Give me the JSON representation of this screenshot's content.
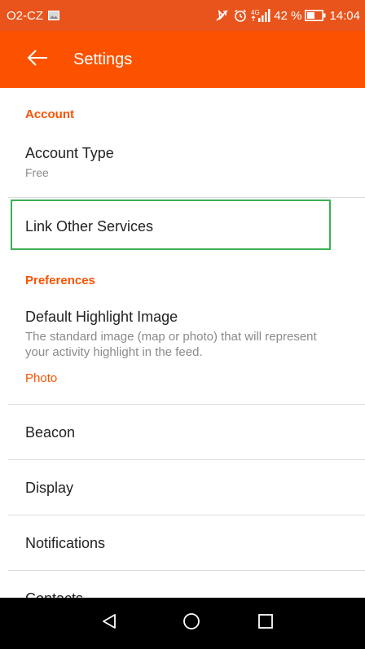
{
  "status_bar": {
    "carrier": "O2-CZ",
    "network": "4G",
    "battery_percent": "42 %",
    "time": "14:04",
    "icons": [
      "image-icon",
      "mute-icon",
      "alarm-icon",
      "signal-icon",
      "battery-icon"
    ]
  },
  "app_bar": {
    "title": "Settings",
    "back_icon": "arrow-left-icon"
  },
  "sections": {
    "account": {
      "header": "Account",
      "account_type": {
        "title": "Account Type",
        "value": "Free"
      },
      "link_services": {
        "title": "Link Other Services"
      }
    },
    "preferences": {
      "header": "Preferences",
      "highlight_image": {
        "title": "Default Highlight Image",
        "description": "The standard image (map or photo) that will represent your activity highlight in the feed.",
        "value": "Photo"
      }
    }
  },
  "items": [
    "Beacon",
    "Display",
    "Notifications",
    "Contacts"
  ],
  "nav_bar": {
    "back": "triangle-back-icon",
    "home": "circle-home-icon",
    "recents": "square-recents-icon"
  },
  "colors": {
    "brand": "#fc5200",
    "status_bar": "#e8541c",
    "focus": "#3cb054",
    "divider": "#dcdcdc"
  }
}
